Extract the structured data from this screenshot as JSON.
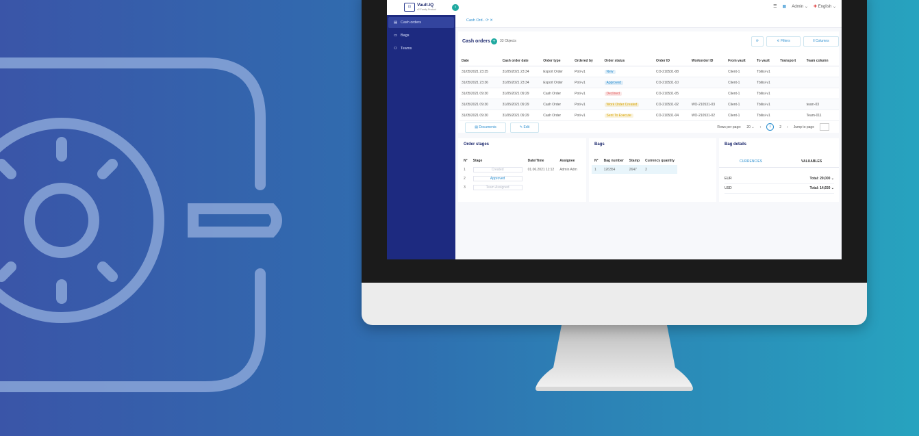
{
  "colors": {
    "sidebar": "#1d2a80",
    "accent": "#1fa9a0",
    "link": "#2a8ecf",
    "background_left": "#3a55a8",
    "background_right": "#27a3bf"
  },
  "topbar": {
    "brand": "Vault.IQ",
    "brand_sub": "x2 Family Product",
    "user": "Admin",
    "language": "English",
    "icons": [
      "menu-icon",
      "layout-icon",
      "flag-icon",
      "chevron-down-icon"
    ]
  },
  "sidebar": {
    "items": [
      {
        "label": "Cash orders",
        "icon": "document-icon",
        "active": true
      },
      {
        "label": "Bags",
        "icon": "bag-icon",
        "active": false
      },
      {
        "label": "Teams",
        "icon": "team-icon",
        "active": false
      }
    ]
  },
  "tabbar": {
    "tab": "Cash Ord..",
    "icons": [
      "refresh-icon",
      "close-icon"
    ]
  },
  "cash_orders": {
    "title": "Cash orders",
    "count": "33 Objects",
    "buttons": {
      "filters": "Filters",
      "columns": "Columns",
      "documents": "Documents",
      "edit": "Edit"
    },
    "columns": [
      "Date",
      "Cash order date",
      "Order type",
      "Ordered by",
      "Order status",
      "Order ID",
      "Workorder ID",
      "From vault",
      "To vault",
      "Transport",
      "Team column"
    ],
    "rows": [
      [
        "31/05/2021 23:35",
        "31/05/2021 23:34",
        "Export Order",
        "Poti-v1",
        "New",
        "CO-210531-08",
        "",
        "Client-1",
        "Tbilisi-v1",
        "",
        ""
      ],
      [
        "31/05/2021 23:36",
        "31/05/2021 23:34",
        "Export Order",
        "Poti-v1",
        "Approved",
        "CO-210531-10",
        "",
        "Client-1",
        "Tbilisi-v1",
        "",
        ""
      ],
      [
        "31/05/2021 09:30",
        "31/05/2021 09:29",
        "Cash Order",
        "Poti-v1",
        "Declined",
        "CO-210531-05",
        "",
        "Client-1",
        "Tbilisi-v1",
        "",
        ""
      ],
      [
        "31/05/2021 09:30",
        "31/05/2021 09:29",
        "Cash Order",
        "Poti-v1",
        "Work Order Created",
        "CO-210531-02",
        "WO-210531-03",
        "Client-1",
        "Tbilisi-v1",
        "",
        "team-03"
      ],
      [
        "31/05/2021 09:30",
        "31/05/2021 09:29",
        "Cash Order",
        "Poti-v1",
        "Sent To Execute",
        "CO-210531-04",
        "WO-210531-02",
        "Client-1",
        "Tbilisi-v1",
        "",
        "Team-011"
      ]
    ],
    "status_colors": {
      "New": "#2a8ecf",
      "Approved": "#2a8ecf",
      "Declined": "#e05656",
      "Work Order Created": "#d9a400",
      "Sent To Execute": "#d9a400"
    },
    "pager": {
      "rows_per_page": "Rows per page:",
      "rows_value": "20",
      "page_current": "1",
      "page_next": "2",
      "jump": "Jump to page"
    }
  },
  "order_stages": {
    "title": "Order stages",
    "columns": [
      "N°",
      "Stage",
      "Date/Time",
      "Assignee"
    ],
    "rows": [
      [
        "1",
        "Created",
        "01.06.2021 11:12",
        "Admin Adm"
      ],
      [
        "2",
        "Approved",
        "",
        ""
      ],
      [
        "3",
        "Team Assigned",
        "",
        ""
      ]
    ]
  },
  "bags": {
    "title": "Bags",
    "columns": [
      "N°",
      "Bag number",
      "Stamp",
      "Currency quantity"
    ],
    "rows": [
      [
        "1",
        "126354",
        "2647",
        "2"
      ]
    ]
  },
  "bag_details": {
    "title": "Bag details",
    "tabs": [
      "CURRENCIES",
      "VALUABLES"
    ],
    "rows": [
      {
        "currency": "EUR",
        "total": "Total: 29,000"
      },
      {
        "currency": "USD",
        "total": "Total: 14,650"
      }
    ]
  }
}
